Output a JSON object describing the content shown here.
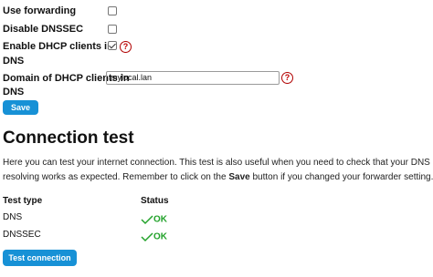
{
  "settings": {
    "use_forwarding_label": "Use forwarding",
    "disable_dnssec_label": "Disable DNSSEC",
    "enable_dhcp_label_line1": "Enable DHCP clients in",
    "enable_dhcp_label_line2": "DNS",
    "domain_label_line1": "Domain of DHCP clients in",
    "domain_label_line2": "DNS",
    "domain_value": "mylocal.lan",
    "help_icon_glyph": "?",
    "save_label": "Save"
  },
  "connection_test": {
    "title": "Connection test",
    "desc_part1": "Here you can test your internet connection. This test is also useful when you need to check that your DNS resolving works as expected. Remember to click on the ",
    "desc_bold": "Save",
    "desc_part2": " button if you changed your forwarder setting.",
    "columns": [
      "Test type",
      "Status"
    ],
    "rows": [
      {
        "type": "DNS",
        "status": "OK"
      },
      {
        "type": "DNSSEC",
        "status": "OK"
      }
    ],
    "test_button_label": "Test connection"
  },
  "colors": {
    "button": "#1791d6",
    "ok": "#22a22a",
    "help": "#c00000"
  },
  "icons": {
    "help": "help-icon",
    "ok": "check-icon"
  }
}
